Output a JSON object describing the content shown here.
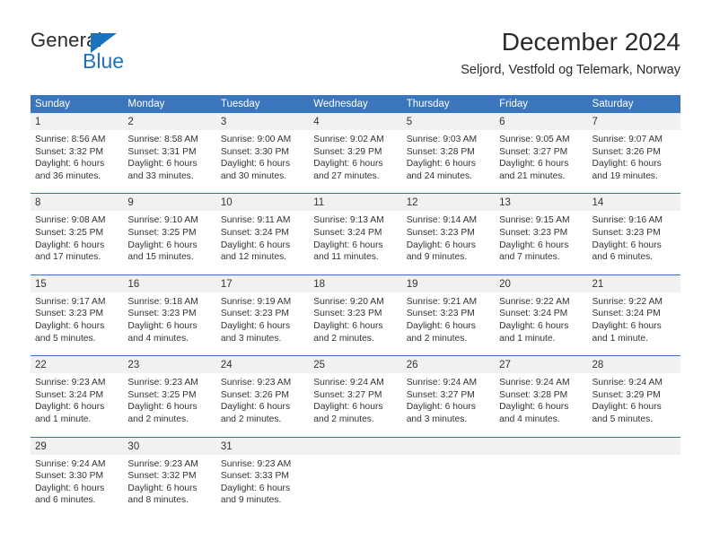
{
  "brand": {
    "name_top": "General",
    "name_bottom": "Blue",
    "triangle_color": "#1d72bd",
    "text_color": "#2b2b2b"
  },
  "header": {
    "title": "December 2024",
    "subtitle": "Seljord, Vestfold og Telemark, Norway"
  },
  "theme": {
    "header_blue": "#3b76bd",
    "daynum_band": "#f1f1f1",
    "text": "#333333",
    "page_bg": "#ffffff"
  },
  "calendar": {
    "day_headers": [
      "Sunday",
      "Monday",
      "Tuesday",
      "Wednesday",
      "Thursday",
      "Friday",
      "Saturday"
    ],
    "weeks": [
      {
        "lead_blanks": 0,
        "days": [
          {
            "num": "1",
            "sunrise": "Sunrise: 8:56 AM",
            "sunset": "Sunset: 3:32 PM",
            "daylight_1": "Daylight: 6 hours",
            "daylight_2": "and 36 minutes."
          },
          {
            "num": "2",
            "sunrise": "Sunrise: 8:58 AM",
            "sunset": "Sunset: 3:31 PM",
            "daylight_1": "Daylight: 6 hours",
            "daylight_2": "and 33 minutes."
          },
          {
            "num": "3",
            "sunrise": "Sunrise: 9:00 AM",
            "sunset": "Sunset: 3:30 PM",
            "daylight_1": "Daylight: 6 hours",
            "daylight_2": "and 30 minutes."
          },
          {
            "num": "4",
            "sunrise": "Sunrise: 9:02 AM",
            "sunset": "Sunset: 3:29 PM",
            "daylight_1": "Daylight: 6 hours",
            "daylight_2": "and 27 minutes."
          },
          {
            "num": "5",
            "sunrise": "Sunrise: 9:03 AM",
            "sunset": "Sunset: 3:28 PM",
            "daylight_1": "Daylight: 6 hours",
            "daylight_2": "and 24 minutes."
          },
          {
            "num": "6",
            "sunrise": "Sunrise: 9:05 AM",
            "sunset": "Sunset: 3:27 PM",
            "daylight_1": "Daylight: 6 hours",
            "daylight_2": "and 21 minutes."
          },
          {
            "num": "7",
            "sunrise": "Sunrise: 9:07 AM",
            "sunset": "Sunset: 3:26 PM",
            "daylight_1": "Daylight: 6 hours",
            "daylight_2": "and 19 minutes."
          }
        ]
      },
      {
        "lead_blanks": 0,
        "days": [
          {
            "num": "8",
            "sunrise": "Sunrise: 9:08 AM",
            "sunset": "Sunset: 3:25 PM",
            "daylight_1": "Daylight: 6 hours",
            "daylight_2": "and 17 minutes."
          },
          {
            "num": "9",
            "sunrise": "Sunrise: 9:10 AM",
            "sunset": "Sunset: 3:25 PM",
            "daylight_1": "Daylight: 6 hours",
            "daylight_2": "and 15 minutes."
          },
          {
            "num": "10",
            "sunrise": "Sunrise: 9:11 AM",
            "sunset": "Sunset: 3:24 PM",
            "daylight_1": "Daylight: 6 hours",
            "daylight_2": "and 12 minutes."
          },
          {
            "num": "11",
            "sunrise": "Sunrise: 9:13 AM",
            "sunset": "Sunset: 3:24 PM",
            "daylight_1": "Daylight: 6 hours",
            "daylight_2": "and 11 minutes."
          },
          {
            "num": "12",
            "sunrise": "Sunrise: 9:14 AM",
            "sunset": "Sunset: 3:23 PM",
            "daylight_1": "Daylight: 6 hours",
            "daylight_2": "and 9 minutes."
          },
          {
            "num": "13",
            "sunrise": "Sunrise: 9:15 AM",
            "sunset": "Sunset: 3:23 PM",
            "daylight_1": "Daylight: 6 hours",
            "daylight_2": "and 7 minutes."
          },
          {
            "num": "14",
            "sunrise": "Sunrise: 9:16 AM",
            "sunset": "Sunset: 3:23 PM",
            "daylight_1": "Daylight: 6 hours",
            "daylight_2": "and 6 minutes."
          }
        ]
      },
      {
        "lead_blanks": 0,
        "days": [
          {
            "num": "15",
            "sunrise": "Sunrise: 9:17 AM",
            "sunset": "Sunset: 3:23 PM",
            "daylight_1": "Daylight: 6 hours",
            "daylight_2": "and 5 minutes."
          },
          {
            "num": "16",
            "sunrise": "Sunrise: 9:18 AM",
            "sunset": "Sunset: 3:23 PM",
            "daylight_1": "Daylight: 6 hours",
            "daylight_2": "and 4 minutes."
          },
          {
            "num": "17",
            "sunrise": "Sunrise: 9:19 AM",
            "sunset": "Sunset: 3:23 PM",
            "daylight_1": "Daylight: 6 hours",
            "daylight_2": "and 3 minutes."
          },
          {
            "num": "18",
            "sunrise": "Sunrise: 9:20 AM",
            "sunset": "Sunset: 3:23 PM",
            "daylight_1": "Daylight: 6 hours",
            "daylight_2": "and 2 minutes."
          },
          {
            "num": "19",
            "sunrise": "Sunrise: 9:21 AM",
            "sunset": "Sunset: 3:23 PM",
            "daylight_1": "Daylight: 6 hours",
            "daylight_2": "and 2 minutes."
          },
          {
            "num": "20",
            "sunrise": "Sunrise: 9:22 AM",
            "sunset": "Sunset: 3:24 PM",
            "daylight_1": "Daylight: 6 hours",
            "daylight_2": "and 1 minute."
          },
          {
            "num": "21",
            "sunrise": "Sunrise: 9:22 AM",
            "sunset": "Sunset: 3:24 PM",
            "daylight_1": "Daylight: 6 hours",
            "daylight_2": "and 1 minute."
          }
        ]
      },
      {
        "lead_blanks": 0,
        "days": [
          {
            "num": "22",
            "sunrise": "Sunrise: 9:23 AM",
            "sunset": "Sunset: 3:24 PM",
            "daylight_1": "Daylight: 6 hours",
            "daylight_2": "and 1 minute."
          },
          {
            "num": "23",
            "sunrise": "Sunrise: 9:23 AM",
            "sunset": "Sunset: 3:25 PM",
            "daylight_1": "Daylight: 6 hours",
            "daylight_2": "and 2 minutes."
          },
          {
            "num": "24",
            "sunrise": "Sunrise: 9:23 AM",
            "sunset": "Sunset: 3:26 PM",
            "daylight_1": "Daylight: 6 hours",
            "daylight_2": "and 2 minutes."
          },
          {
            "num": "25",
            "sunrise": "Sunrise: 9:24 AM",
            "sunset": "Sunset: 3:27 PM",
            "daylight_1": "Daylight: 6 hours",
            "daylight_2": "and 2 minutes."
          },
          {
            "num": "26",
            "sunrise": "Sunrise: 9:24 AM",
            "sunset": "Sunset: 3:27 PM",
            "daylight_1": "Daylight: 6 hours",
            "daylight_2": "and 3 minutes."
          },
          {
            "num": "27",
            "sunrise": "Sunrise: 9:24 AM",
            "sunset": "Sunset: 3:28 PM",
            "daylight_1": "Daylight: 6 hours",
            "daylight_2": "and 4 minutes."
          },
          {
            "num": "28",
            "sunrise": "Sunrise: 9:24 AM",
            "sunset": "Sunset: 3:29 PM",
            "daylight_1": "Daylight: 6 hours",
            "daylight_2": "and 5 minutes."
          }
        ]
      },
      {
        "lead_blanks": 0,
        "days": [
          {
            "num": "29",
            "sunrise": "Sunrise: 9:24 AM",
            "sunset": "Sunset: 3:30 PM",
            "daylight_1": "Daylight: 6 hours",
            "daylight_2": "and 6 minutes."
          },
          {
            "num": "30",
            "sunrise": "Sunrise: 9:23 AM",
            "sunset": "Sunset: 3:32 PM",
            "daylight_1": "Daylight: 6 hours",
            "daylight_2": "and 8 minutes."
          },
          {
            "num": "31",
            "sunrise": "Sunrise: 9:23 AM",
            "sunset": "Sunset: 3:33 PM",
            "daylight_1": "Daylight: 6 hours",
            "daylight_2": "and 9 minutes."
          }
        ]
      }
    ]
  }
}
